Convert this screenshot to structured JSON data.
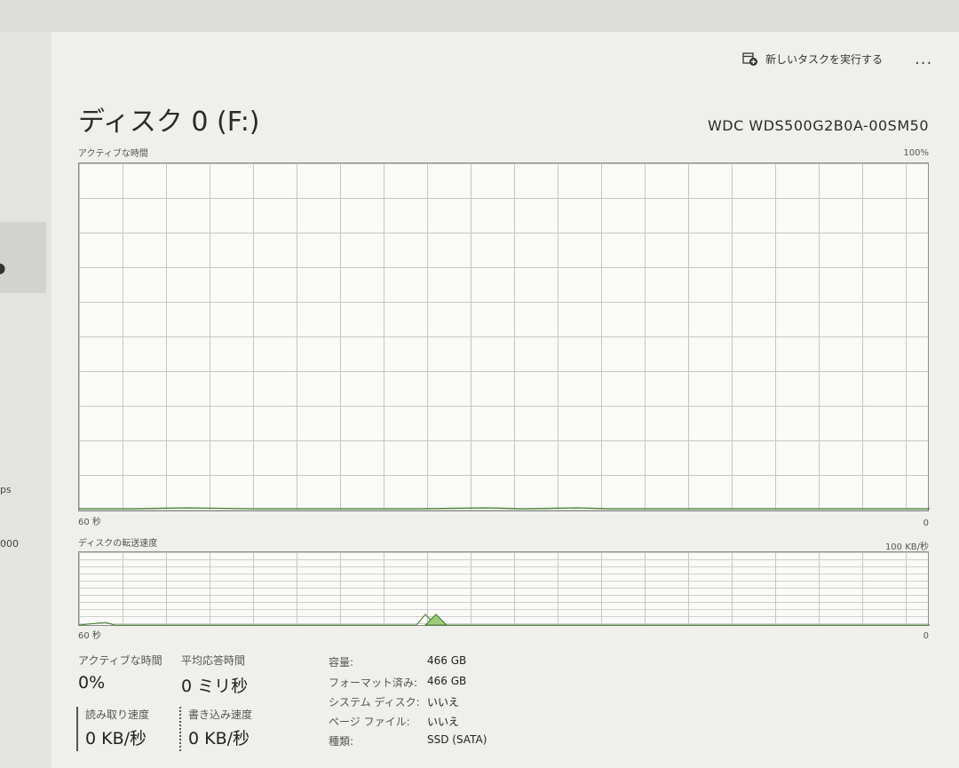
{
  "sidebar": {
    "partial_label_1": "ps",
    "partial_label_2": "000"
  },
  "toolbar": {
    "run_task_label": "新しいタスクを実行する",
    "more_label": "..."
  },
  "disk": {
    "title": "ディスク 0 (F:)",
    "model": "WDC WDS500G2B0A-00SM50"
  },
  "active_graph": {
    "label": "アクティブな時間",
    "max_label": "100%",
    "time_label": "60 秒",
    "min_label": "0"
  },
  "transfer_graph": {
    "label": "ディスクの転送速度",
    "max_label": "100 KB/秒",
    "time_label": "60 秒",
    "min_label": "0"
  },
  "stats": {
    "active_time_label": "アクティブな時間",
    "active_time_value": "0%",
    "avg_response_label": "平均応答時間",
    "avg_response_value": "0 ミリ秒",
    "read_speed_label": "読み取り速度",
    "read_speed_value": "0 KB/秒",
    "write_speed_label": "書き込み速度",
    "write_speed_value": "0 KB/秒"
  },
  "info": {
    "capacity_label": "容量:",
    "capacity_value": "466 GB",
    "formatted_label": "フォーマット済み:",
    "formatted_value": "466 GB",
    "system_disk_label": "システム ディスク:",
    "system_disk_value": "いいえ",
    "page_file_label": "ページ ファイル:",
    "page_file_value": "いいえ",
    "type_label": "種類:",
    "type_value": "SSD (SATA)"
  },
  "colors": {
    "graph_line": "#3f7a2a",
    "graph_fill": "#9ccc7a",
    "grid": "#c6c6c4"
  }
}
